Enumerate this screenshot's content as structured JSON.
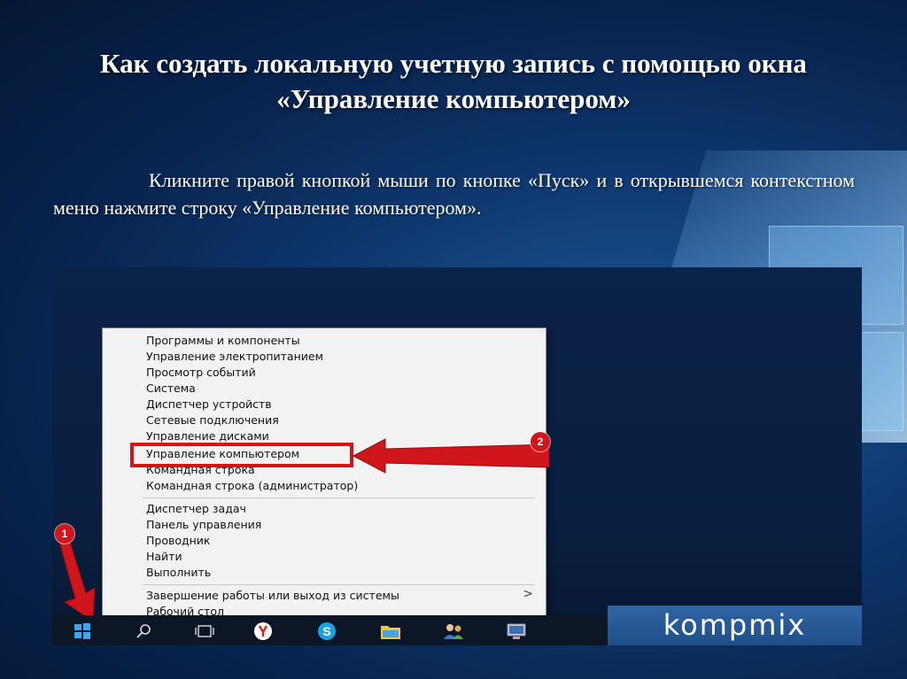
{
  "slide": {
    "title": "Как создать локальную учетную запись с помощью окна «Управление компьютером»",
    "body": "Кликните правой кнопкой мыши по кнопке «Пуск» и в открывшемся контекстном меню нажмите строку «Управление компьютером»."
  },
  "context_menu": {
    "items": [
      "Программы и компоненты",
      "Управление электропитанием",
      "Просмотр событий",
      "Система",
      "Диспетчер устройств",
      "Сетевые подключения",
      "Управление дисками",
      "Управление компьютером",
      "Командная строка",
      "Командная строка (администратор)",
      "Диспетчер задач",
      "Панель управления",
      "Проводник",
      "Найти",
      "Выполнить",
      "Завершение работы или выход из системы",
      "Рабочий стол"
    ],
    "highlighted": "Управление компьютером",
    "submenu_arrow": ">"
  },
  "badges": {
    "step1": "1",
    "step2": "2"
  },
  "taskbar": {
    "icons": [
      "windows-start-icon",
      "search-icon",
      "task-view-icon",
      "yandex-browser-icon",
      "skype-icon",
      "file-explorer-icon",
      "people-icon",
      "computer-icon"
    ]
  },
  "watermark": "kompmix",
  "colors": {
    "accent_red": "#d0151b",
    "menu_bg": "#f2f2f2",
    "title_text": "#ffffff"
  }
}
